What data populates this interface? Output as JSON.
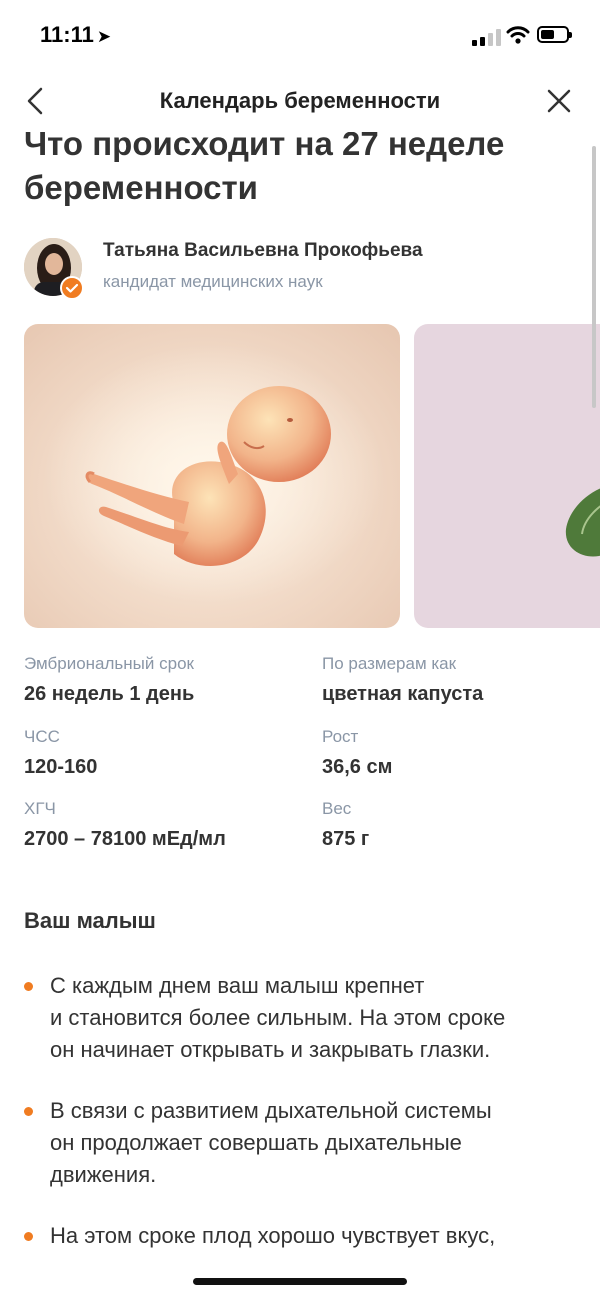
{
  "status_bar": {
    "time": "11:11"
  },
  "nav": {
    "title": "Календарь беременности"
  },
  "article": {
    "title": "Что происходит на 27 неделе беременности",
    "author": {
      "name": "Татьяна Васильевна Прокофьева",
      "title": "кандидат медицинских наук"
    },
    "facts": [
      {
        "label": "Эмбриональный срок",
        "value": "26 недель 1 день"
      },
      {
        "label": "По размерам как",
        "value": "цветная капуста"
      },
      {
        "label": "ЧСС",
        "value": "120-160"
      },
      {
        "label": "Рост",
        "value": "36,6 см"
      },
      {
        "label": "ХГЧ",
        "value": "2700 – 78100 мЕд/мл"
      },
      {
        "label": "Вес",
        "value": "875 г"
      }
    ],
    "section_title": "Ваш малыш",
    "bullets": [
      "С каждым днем ваш малыш крепнет\nи становится более сильным. На этом сроке\nон начинает открывать и закрывать глазки.",
      "В связи с развитием дыхательной системы\nон продолжает совершать дыхательные\nдвижения.",
      "На этом сроке плод хорошо чувствует вкус,"
    ]
  },
  "colors": {
    "accent": "#f07c21",
    "muted_text": "#8a96a6",
    "primary_text": "#333333",
    "food_card_bg": "#e6d6df"
  },
  "icons": [
    "location-arrow-icon",
    "signal-icon",
    "wifi-icon",
    "battery-icon",
    "back-chevron-icon",
    "close-icon",
    "verified-badge-icon"
  ]
}
